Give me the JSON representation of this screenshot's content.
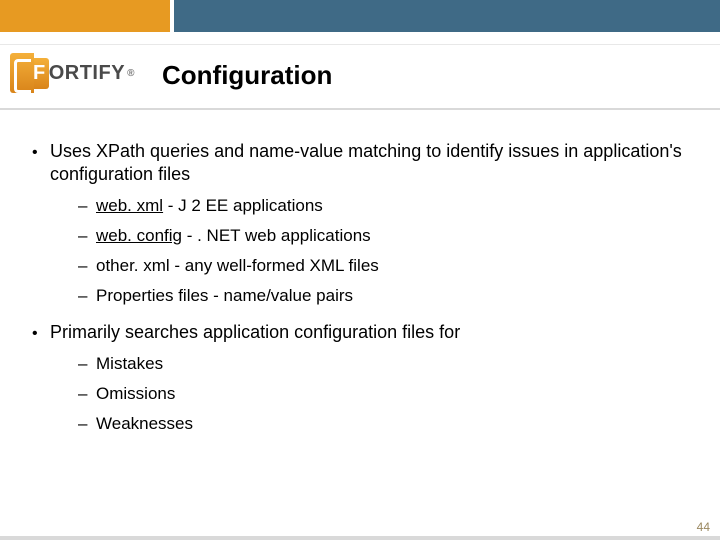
{
  "brand": {
    "lead": "F",
    "rest": "ORTIFY",
    "reg": "®"
  },
  "title": "Configuration",
  "bullets": [
    {
      "text": "Uses XPath queries and name-value matching to identify issues in application's configuration files",
      "subs": [
        {
          "u": "web. xml",
          "rest": " -  J 2 EE applications"
        },
        {
          "u": "web. config",
          "rest": " - . NET web applications"
        },
        {
          "plain": "other. xml - any well-formed XML files"
        },
        {
          "plain": "Properties files - name/value pairs"
        }
      ]
    },
    {
      "text": "Primarily searches application configuration files for",
      "subs": [
        {
          "plain": "Mistakes"
        },
        {
          "plain": "Omissions"
        },
        {
          "plain": "Weaknesses"
        }
      ]
    }
  ],
  "page_number": "44"
}
